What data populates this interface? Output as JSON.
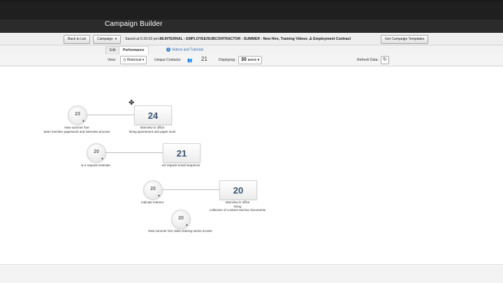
{
  "header": {
    "title": "Campaign Builder"
  },
  "toolbar": {
    "back_label": "Back to List",
    "campaign_menu": "Campaign",
    "saved_prefix": "Saved at 6:26:03 pm:",
    "campaign_name": "88.INTERNAL - EMPLOYEE/SUBCONTRACTOR - SUMMER - New Hire, Training Videos ,& Employment Contract",
    "templates_label": "Get Campaign Templates"
  },
  "tabs": {
    "edit": "Edit",
    "performance": "Performance",
    "videos_link": "Videos and Tutorials"
  },
  "filters": {
    "view_label": "View:",
    "view_value": "Historical",
    "unique_label": "Unique Contacts:",
    "unique_value": "21",
    "displaying_label": "Displaying:",
    "displaying_value": "30",
    "days_label": "DAYS",
    "refresh_label": "Refresh Data:"
  },
  "flows": [
    {
      "source_count": "23",
      "source_caption": [
        "New summer hire",
        "team member paperwork and interview process"
      ],
      "target_count": "24",
      "target_caption": [
        "Interview in office",
        "hiring apointment and paper work"
      ]
    },
    {
      "source_count": "20",
      "source_caption": [
        "w-4 request estimate"
      ],
      "target_count": "21",
      "target_caption": [
        "w4 request email sequence"
      ]
    },
    {
      "source_count": "20",
      "source_caption": [
        "Indicate interest"
      ],
      "target_count": "20",
      "target_caption": [
        "Interview in office",
        "hiring",
        "collection of contract and tax documents"
      ]
    },
    {
      "source_count": "20",
      "source_caption": [
        "New summer hire video training series & tests"
      ]
    }
  ],
  "icons": {
    "person": "person-icon",
    "refresh": "refresh-icon",
    "info": "info-icon",
    "cursor": "move-cursor-icon"
  }
}
